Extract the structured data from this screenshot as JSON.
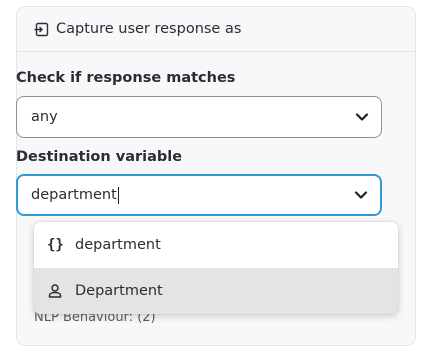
{
  "header": {
    "icon": "capture-input-icon",
    "title": "Capture user response as"
  },
  "match_field": {
    "label": "Check if response matches",
    "value": "any",
    "icon": "chevron-down-icon"
  },
  "destination_field": {
    "label": "Destination variable",
    "value": "department",
    "icon": "chevron-down-icon"
  },
  "dropdown": {
    "options": [
      {
        "icon": "variable-braces-icon",
        "glyph": "{}",
        "label": "department"
      },
      {
        "icon": "user-icon",
        "label": "Department"
      }
    ]
  },
  "obscured": {
    "text": "NLP Behaviour: (2)"
  },
  "colors": {
    "focus_border": "#2f9bd6",
    "highlight": "#e4e4e4",
    "card_bg": "#f7f8fa"
  }
}
